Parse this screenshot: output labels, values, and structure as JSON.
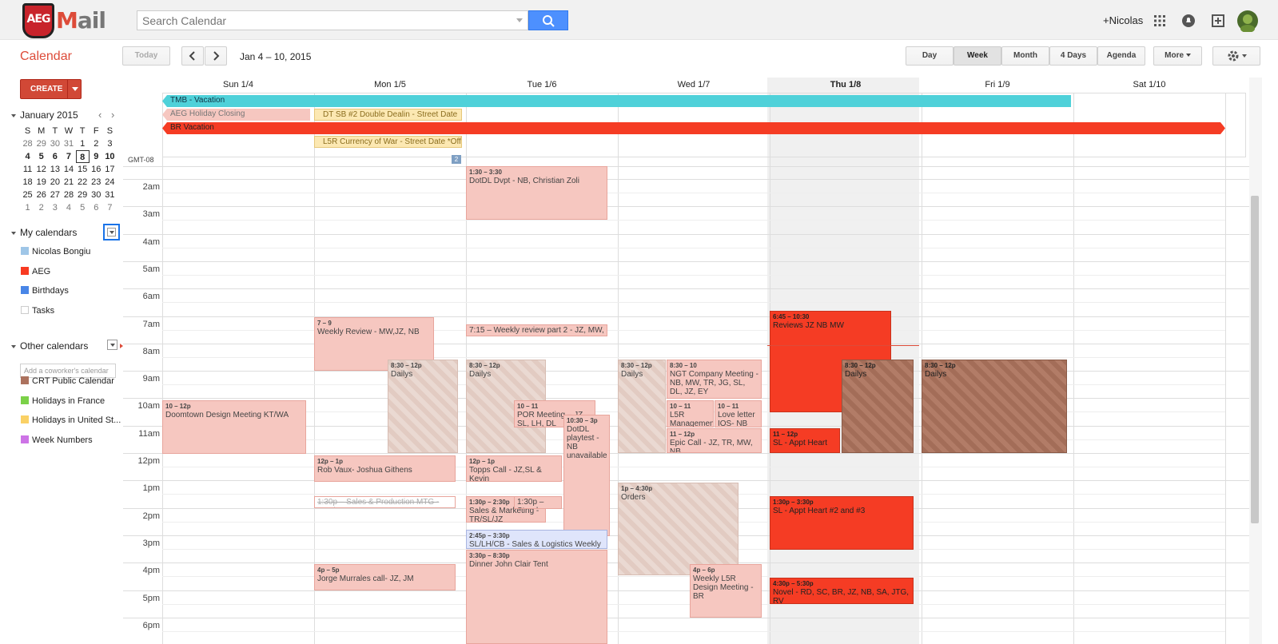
{
  "header": {
    "logo_left": "AEG",
    "logo_right": "Mail",
    "search_placeholder": "Search Calendar",
    "user": "+Nicolas"
  },
  "toolbar": {
    "title": "Calendar",
    "today": "Today",
    "date_range": "Jan 4 – 10, 2015",
    "views": [
      "Day",
      "Week",
      "Month",
      "4 Days",
      "Agenda"
    ],
    "more": "More"
  },
  "sidebar": {
    "create": "CREATE",
    "mini_title": "January 2015",
    "weekdays": [
      "S",
      "M",
      "T",
      "W",
      "T",
      "F",
      "S"
    ],
    "weeks": [
      [
        "28",
        "29",
        "30",
        "31",
        "1",
        "2",
        "3"
      ],
      [
        "4",
        "5",
        "6",
        "7",
        "8",
        "9",
        "10"
      ],
      [
        "11",
        "12",
        "13",
        "14",
        "15",
        "16",
        "17"
      ],
      [
        "18",
        "19",
        "20",
        "21",
        "22",
        "23",
        "24"
      ],
      [
        "25",
        "26",
        "27",
        "28",
        "29",
        "30",
        "31"
      ],
      [
        "1",
        "2",
        "3",
        "4",
        "5",
        "6",
        "7"
      ]
    ],
    "my_calendars_title": "My calendars",
    "my_calendars": [
      {
        "label": "Nicolas Bongiu",
        "color": "#9fc6e7"
      },
      {
        "label": "AEG",
        "color": "#f83a22"
      },
      {
        "label": "Birthdays",
        "color": "#4986e7"
      },
      {
        "label": "Tasks",
        "color": "#ffffff"
      }
    ],
    "other_calendars_title": "Other calendars",
    "add_placeholder": "Add a coworker's calendar",
    "other_calendars": [
      {
        "label": "CRT Public Calendar",
        "color": "#ac725e"
      },
      {
        "label": "Holidays in France",
        "color": "#7bd148"
      },
      {
        "label": "Holidays in United St...",
        "color": "#fad165"
      },
      {
        "label": "Week Numbers",
        "color": "#cd74e6"
      }
    ]
  },
  "days": [
    "Sun 1/4",
    "Mon 1/5",
    "Tue 1/6",
    "Wed 1/7",
    "Thu 1/8",
    "Fri 1/9",
    "Sat 1/10"
  ],
  "timezone": "GMT-08",
  "more_badge": "2",
  "hours": [
    "2am",
    "3am",
    "4am",
    "5am",
    "6am",
    "7am",
    "8am",
    "9am",
    "10am",
    "11am",
    "12pm",
    "1pm",
    "2pm",
    "3pm",
    "4pm",
    "5pm",
    "6pm"
  ],
  "allday_events": [
    {
      "title": "TMB - Vacation",
      "color": "#4fd1d9"
    },
    {
      "title": "AEG Holiday Closing",
      "color": "#f6c7c0"
    },
    {
      "title": "DT SB #2 Double Dealin - Street Date",
      "color": "#fce8b2"
    },
    {
      "title": "BR Vacation",
      "color": "#f53c24"
    },
    {
      "title": "L5R Currency of War - Street Date *Offi",
      "color": "#fce8b2"
    }
  ],
  "events": [
    {
      "time": "1:30 – 3:30",
      "title": "DotDL Dvpt - NB, Christian Zoli"
    },
    {
      "time": "7 – 9",
      "title": "Weekly Review - MW,JZ, NB"
    },
    {
      "time": "",
      "title": "7:15 – Weekly review part 2 - JZ, MW, NE"
    },
    {
      "time": "6:45 – 10:30",
      "title": "Reviews JZ NB MW"
    },
    {
      "time": "8:30 – 12p",
      "title": "Dailys"
    },
    {
      "time": "8:30 – 12p",
      "title": "Dailys"
    },
    {
      "time": "8:30 – 12p",
      "title": "Dailys"
    },
    {
      "time": "8:30 – 10",
      "title": "NGT Company Meeting - NB, MW, TR, JG, SL, DL, JZ, EY"
    },
    {
      "time": "8:30 – 12p",
      "title": "Dailys"
    },
    {
      "time": "8:30 – 12p",
      "title": "Dailys"
    },
    {
      "time": "10 – 12p",
      "title": "Doomtown Design Meeting KT/WA"
    },
    {
      "time": "10 – 11",
      "title": "POR Meeting – JZ, SL, LH, DL"
    },
    {
      "time": "10:30 – 3p",
      "title": "DotDL playtest - NB unavailable"
    },
    {
      "time": "10 – 11",
      "title": "L5R Management Meeting: JTG"
    },
    {
      "time": "10 – 11",
      "title": "Love letter IOS- NB"
    },
    {
      "time": "11 – 12p",
      "title": "Epic Call - JZ, TR, MW, NB"
    },
    {
      "time": "11 – 12p",
      "title": "SL - Appt Heart"
    },
    {
      "time": "12p – 1p",
      "title": "Rob Vaux- Joshua Githens"
    },
    {
      "time": "12p – 1p",
      "title": "Topps Call - JZ,SL & Kevin"
    },
    {
      "time": "",
      "title": "1:30p – Sales & Production MTG - Week"
    },
    {
      "time": "1:30p – 2:30p",
      "title": "Sales & Marketing - TR/SL/JZ"
    },
    {
      "time": "",
      "title": "1:30p – Standup"
    },
    {
      "time": "1p – 4:30p",
      "title": "Orders"
    },
    {
      "time": "1:30p – 3:30p",
      "title": "SL - Appt Heart #2 and #3"
    },
    {
      "time": "2:45p – 3:30p",
      "title": "SL/LH/CB - Sales & Logistics Weekly"
    },
    {
      "time": "3:30p – 8:30p",
      "title": "Dinner John Clair Tent"
    },
    {
      "time": "4p – 5p",
      "title": "Jorge Murrales call- JZ, JM"
    },
    {
      "time": "4p – 6p",
      "title": "Weekly L5R Design Meeting - BR"
    },
    {
      "time": "4:30p – 5:30p",
      "title": "Novel - RD, SC, BR, JZ, NB, SA, JTG, RV"
    }
  ]
}
